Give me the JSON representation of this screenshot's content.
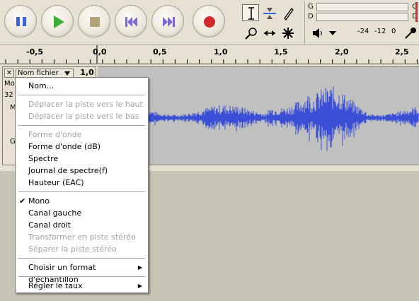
{
  "toolbar": {
    "buttons": [
      {
        "name": "pause-icon",
        "color": "#3a64d8"
      },
      {
        "name": "play-icon",
        "color": "#3fae39"
      },
      {
        "name": "stop-icon",
        "color": "#b3a47a"
      },
      {
        "name": "skip-start-icon",
        "color": "#7a66d6"
      },
      {
        "name": "skip-end-icon",
        "color": "#7a66d6"
      },
      {
        "name": "record-icon",
        "color": "#d32b2b"
      }
    ],
    "tools": [
      "selection-tool-icon",
      "envelope-tool-icon",
      "draw-tool-icon",
      "zoom-tool-icon",
      "timeshift-tool-icon",
      "multi-tool-icon"
    ],
    "meters": {
      "playback_l": "G",
      "playback_r": "D",
      "record_l": "G",
      "record_r": "D",
      "scale": [
        "-24",
        "-12",
        "0"
      ]
    }
  },
  "ruler": {
    "labels": [
      "-0,5",
      "0,0",
      "0,5",
      "1,0",
      "1,5",
      "2,0",
      "2,5"
    ]
  },
  "track": {
    "close": "✕",
    "name_label": "Nom fichier",
    "rate": "1,0",
    "partial_mo": "Mo",
    "partial_32": "32",
    "partial_m": "M",
    "partial_g": "G"
  },
  "menu": {
    "items": [
      {
        "label": "Nom...",
        "enabled": true
      },
      {
        "sep": true
      },
      {
        "label": "Déplacer la piste vers le haut",
        "enabled": false
      },
      {
        "label": "Déplacer la piste vers le bas",
        "enabled": false
      },
      {
        "sep": true
      },
      {
        "label": "Forme d'onde",
        "enabled": false
      },
      {
        "label": "Forme d'onde (dB)",
        "enabled": true
      },
      {
        "label": "Spectre",
        "enabled": true
      },
      {
        "label": "Journal de spectre(f)",
        "enabled": true
      },
      {
        "label": "Hauteur (EAC)",
        "enabled": true
      },
      {
        "sep": true
      },
      {
        "label": "Mono",
        "enabled": true,
        "checked": true
      },
      {
        "label": "Canal gauche",
        "enabled": true
      },
      {
        "label": "Canal droit",
        "enabled": true
      },
      {
        "label": "Transformer en piste stéréo",
        "enabled": false
      },
      {
        "label": "Séparer la piste stéréo",
        "enabled": false
      },
      {
        "sep": true
      },
      {
        "label": "Choisir un format d'échantillon",
        "enabled": true,
        "submenu": true
      },
      {
        "sep": true
      },
      {
        "label": "Régler le taux",
        "enabled": true,
        "submenu": true
      }
    ]
  }
}
